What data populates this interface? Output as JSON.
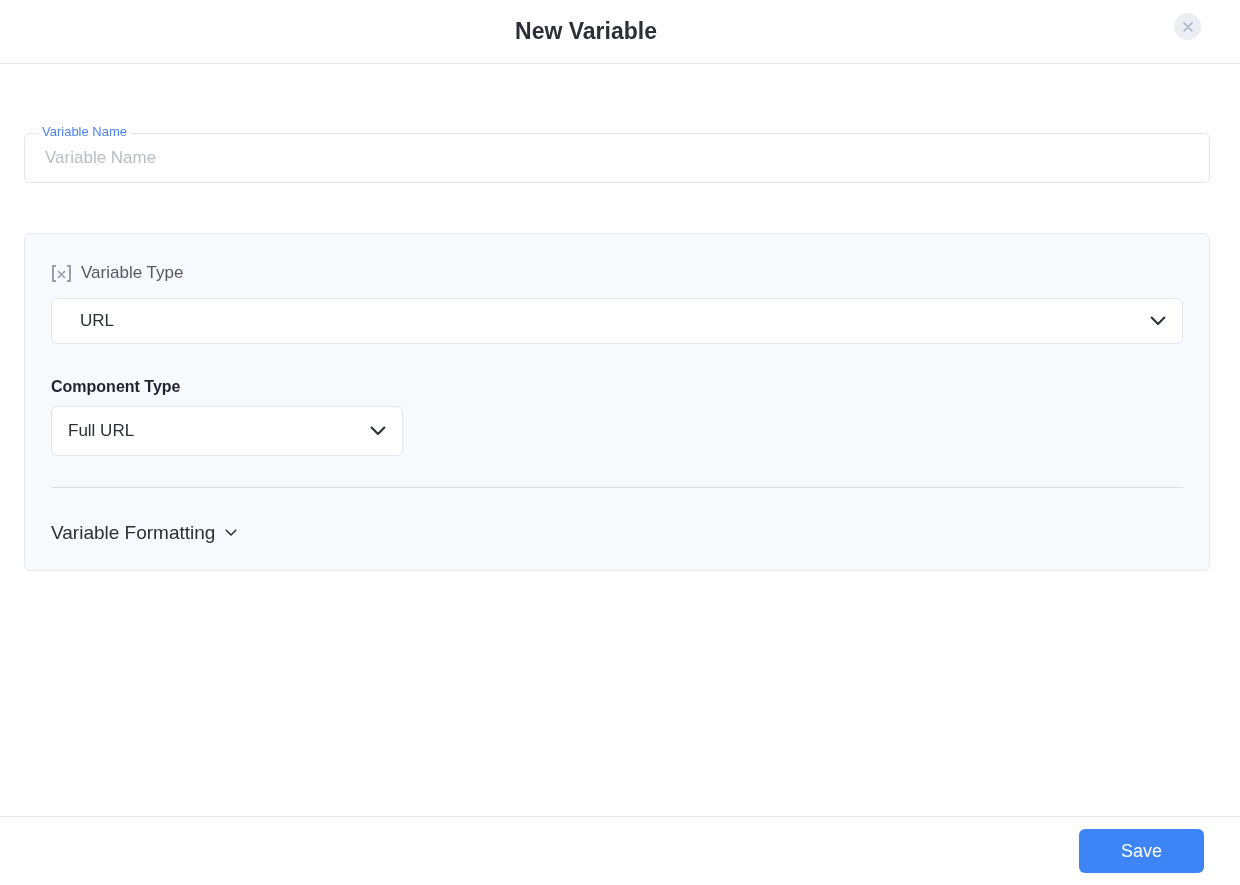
{
  "dialog": {
    "title": "New Variable"
  },
  "variable_name": {
    "label": "Variable Name",
    "placeholder": "Variable Name"
  },
  "variable_type": {
    "label": "Variable Type",
    "value": "URL"
  },
  "component_type": {
    "label": "Component Type",
    "value": "Full URL"
  },
  "formatting": {
    "label": "Variable Formatting",
    "expanded": false
  },
  "footer": {
    "save": "Save"
  }
}
